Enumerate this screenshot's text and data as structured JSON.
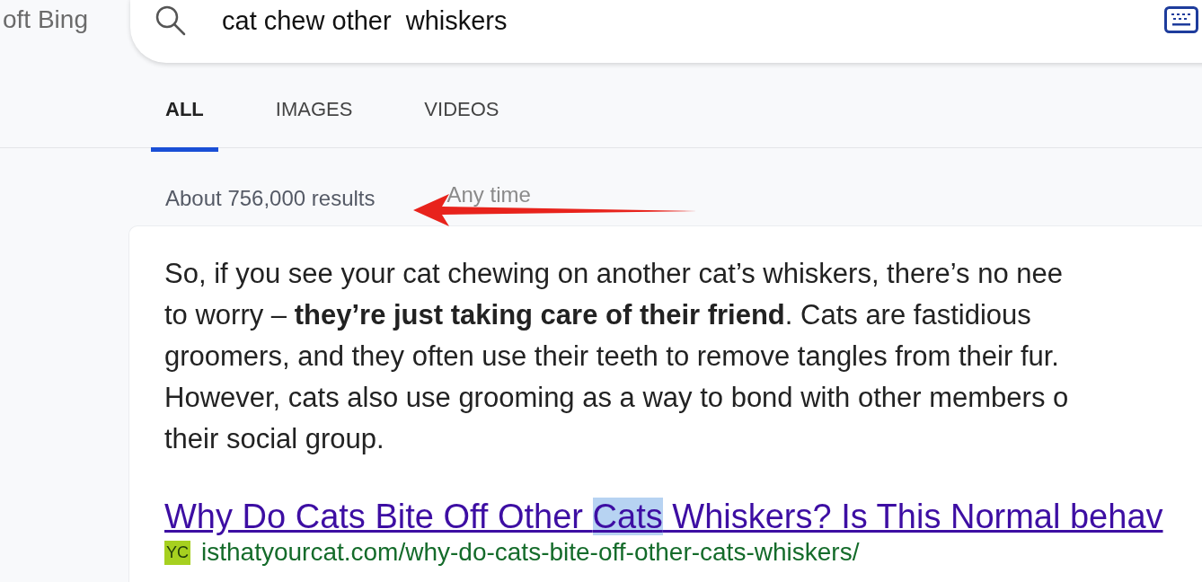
{
  "logo": {
    "text": "oft Bing"
  },
  "search": {
    "value": "cat chew other  whiskers"
  },
  "tabs": [
    {
      "label": "ALL",
      "selected": true
    },
    {
      "label": "IMAGES",
      "selected": false
    },
    {
      "label": "VIDEOS",
      "selected": false
    }
  ],
  "results_count": "About 756,000 results",
  "time_filter": "Any time",
  "snippet": "So, if you see your cat chewing on another cat’s whiskers, there’s no nee\nto worry – **they’re just taking care of their friend**. Cats are fastidious\ngroomers, and they often use their teeth to remove tangles from their fur.\nHowever, cats also use grooming as a way to bond with other members o\ntheir social group.",
  "result": {
    "title_parts": [
      {
        "text": "Why Do Cats Bite Off Other ",
        "highlighted": false
      },
      {
        "text": "Cats",
        "highlighted": true
      },
      {
        "text": " Whiskers? Is This Normal behav",
        "highlighted": false
      }
    ],
    "favicon": "YC",
    "url": "isthatyourcat.com/why-do-cats-bite-off-other-cats-whiskers/"
  }
}
